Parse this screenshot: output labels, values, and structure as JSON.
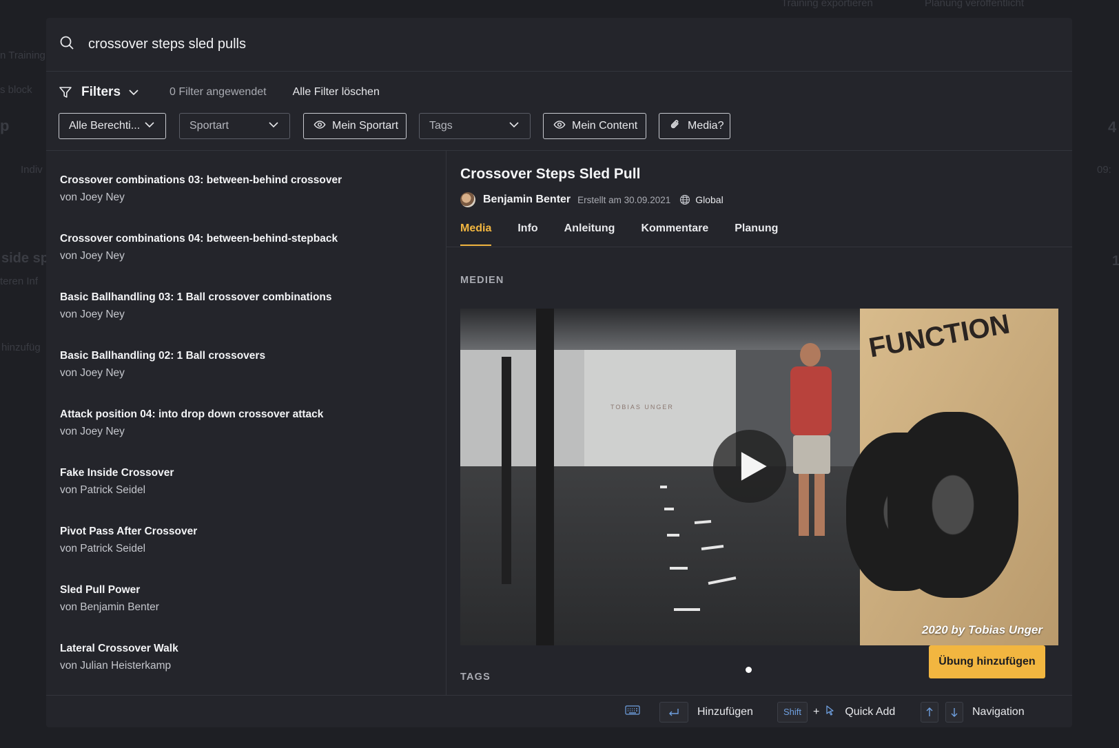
{
  "background": {
    "top_items": [
      "Training exportieren",
      "Planung veröffentlicht"
    ],
    "fragments": [
      "n Training",
      "s block",
      "p",
      "Indiv",
      "side sp",
      "teren Inf",
      "hinzufüg",
      "4",
      "09:",
      "1"
    ]
  },
  "search": {
    "query": "crossover steps sled pulls"
  },
  "filters": {
    "label": "Filters",
    "applied_count": "0 Filter angewendet",
    "clear_label": "Alle Filter löschen",
    "chips": [
      {
        "label": "Alle Berechti...",
        "kind": "dropdown"
      },
      {
        "label": "Sportart",
        "kind": "dropdown-placeholder"
      },
      {
        "label": "Mein Sportart",
        "kind": "toggle",
        "icon": "eye-icon"
      },
      {
        "label": "Tags",
        "kind": "dropdown-placeholder"
      },
      {
        "label": "Mein Content",
        "kind": "toggle",
        "icon": "eye-icon"
      },
      {
        "label": "Media?",
        "kind": "toggle",
        "icon": "paperclip-icon"
      }
    ]
  },
  "results": [
    {
      "title": "Crossover combinations 03: between-behind crossover",
      "author": "von Joey Ney"
    },
    {
      "title": "Crossover combinations 04: between-behind-stepback",
      "author": "von Joey Ney"
    },
    {
      "title": "Basic Ballhandling 03: 1 Ball crossover combinations",
      "author": "von Joey Ney"
    },
    {
      "title": "Basic Ballhandling 02: 1 Ball crossovers",
      "author": "von Joey Ney"
    },
    {
      "title": "Attack position 04: into drop down crossover attack",
      "author": "von Joey Ney"
    },
    {
      "title": "Fake Inside Crossover",
      "author": "von Patrick Seidel"
    },
    {
      "title": "Pivot Pass After Crossover",
      "author": "von Patrick Seidel"
    },
    {
      "title": "Sled Pull Power",
      "author": "von Benjamin Benter"
    },
    {
      "title": "Lateral Crossover Walk",
      "author": "von Julian Heisterkamp"
    }
  ],
  "detail": {
    "title": "Crossover Steps Sled Pull",
    "author": "Benjamin Benter",
    "created": "Erstellt am 30.09.2021",
    "visibility": "Global",
    "tabs": [
      "Media",
      "Info",
      "Anleitung",
      "Kommentare",
      "Planung"
    ],
    "active_tab": "Media",
    "media_label": "MEDIEN",
    "tags_label": "TAGS",
    "video": {
      "brand_text": "FUNCTION",
      "wall_text": "TOBIAS UNGER",
      "watermark": "2020 by Tobias Unger"
    },
    "carousel_dots": 1,
    "add_button": "Übung hinzufügen"
  },
  "footer": {
    "add_label": "Hinzufügen",
    "shift_label": "Shift",
    "plus": "+",
    "quick_add_label": "Quick Add",
    "navigation_label": "Navigation"
  },
  "colors": {
    "accent": "#f2b640",
    "modal_bg": "#24252b",
    "page_bg": "#1b1c21",
    "key_hint": "#6fa0e0"
  }
}
